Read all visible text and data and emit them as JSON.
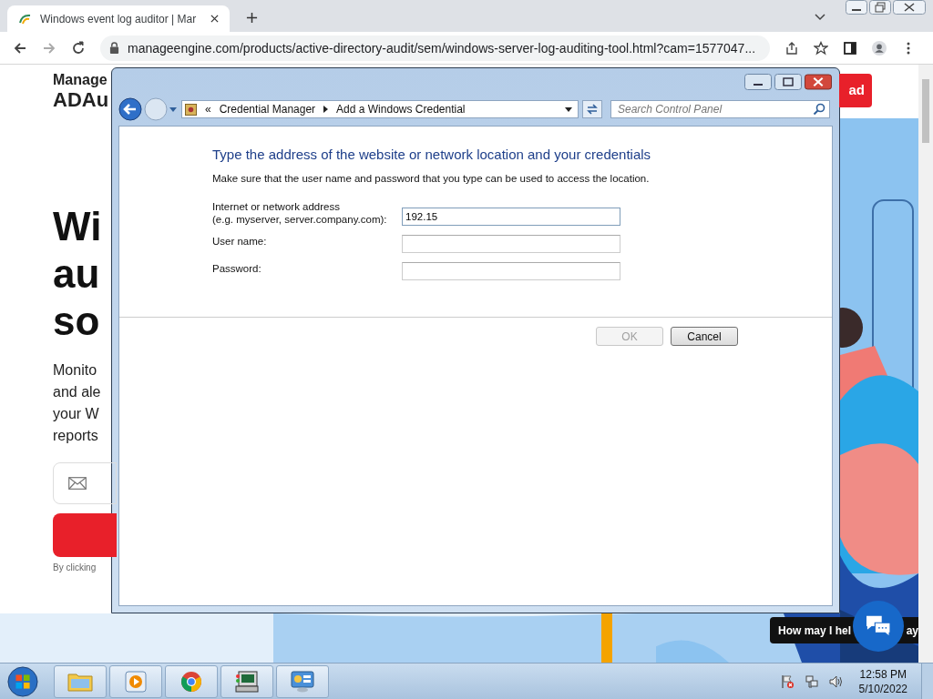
{
  "browser": {
    "tab": {
      "title": "Windows event log auditor | Mar"
    },
    "address": "manageengine.com/products/active-directory-audit/sem/windows-server-log-auditing-tool.html?cam=1577047..."
  },
  "page": {
    "logo": [
      "Manage",
      "ADAu"
    ],
    "header_button": "ad",
    "headline": [
      "Wi",
      "au",
      "so"
    ],
    "intro": [
      "Monito",
      "and ale",
      "your W",
      "reports"
    ],
    "consent": "By clicking",
    "chat": {
      "prompt": "How may I hel",
      "prompt_tail": "ay"
    }
  },
  "dialog": {
    "breadcrumb_overflow": "«",
    "breadcrumb": [
      "Credential Manager",
      "Add a Windows Credential"
    ],
    "search": {
      "placeholder": "Search Control Panel"
    },
    "heading": "Type the address of the website or network location and your credentials",
    "description": "Make sure that the user name and password that you type can be used to access the location.",
    "fields": [
      {
        "label": "Internet or network address",
        "hint": "(e.g. myserver, server.company.com):",
        "value": "192.15"
      },
      {
        "label": "User name:"
      },
      {
        "label": "Password:"
      }
    ],
    "buttons": [
      {
        "label": "OK",
        "disabled": true
      },
      {
        "label": "Cancel",
        "disabled": false
      }
    ]
  },
  "taskbar": {
    "apps": [
      {
        "kind": "folder"
      },
      {
        "kind": "media"
      },
      {
        "kind": "chrome"
      },
      {
        "kind": "terminal"
      },
      {
        "kind": "control-panel"
      }
    ],
    "time": "12:58 PM",
    "date": "5/10/2022"
  }
}
